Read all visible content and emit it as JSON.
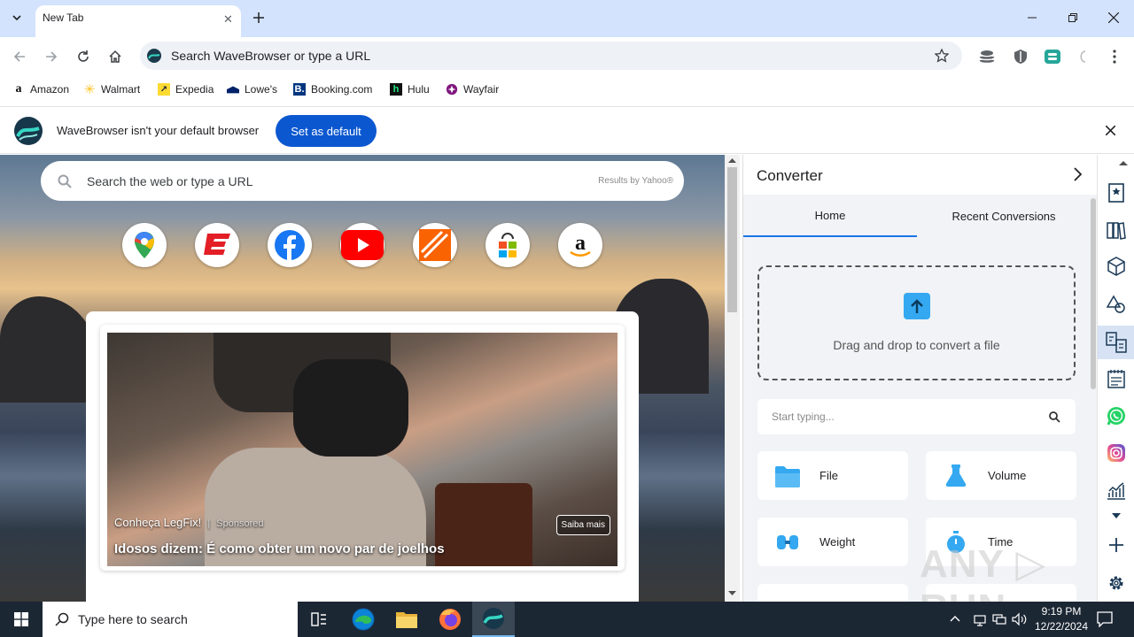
{
  "browser": {
    "tab_title": "New Tab",
    "omnibox_placeholder": "Search WaveBrowser or type a URL",
    "bookmarks": [
      "Amazon",
      "Walmart",
      "Expedia",
      "Lowe's",
      "Booking.com",
      "Hulu",
      "Wayfair"
    ],
    "infobar": {
      "message": "WaveBrowser isn't your default browser",
      "button": "Set as default"
    }
  },
  "newtab": {
    "search_placeholder": "Search the web or type a URL",
    "search_provider": "Results by Yahoo®",
    "shortcuts": [
      "google-maps",
      "espn",
      "facebook",
      "youtube",
      "the-home-depot",
      "microsoft-store",
      "amazon"
    ],
    "ad": {
      "brand": "Conheça LegFix!",
      "sponsored": "Sponsored",
      "cta": "Saiba mais",
      "headline": "Idosos dizem: É como obter um novo par de joelhos"
    }
  },
  "panel": {
    "title": "Converter",
    "tabs": [
      "Home",
      "Recent Conversions"
    ],
    "active_tab": "Home",
    "dropzone": "Drag and drop to convert a file",
    "search_placeholder": "Start typing...",
    "categories": [
      "File",
      "Volume",
      "Weight",
      "Time"
    ]
  },
  "taskbar": {
    "search_placeholder": "Type here to search",
    "time": "9:19 PM",
    "date": "12/22/2024"
  },
  "watermark": "ANY RUN",
  "colors": {
    "titlebar": "#d3e3fd",
    "accent": "#0b57d0",
    "taskbar": "#1c2734"
  }
}
